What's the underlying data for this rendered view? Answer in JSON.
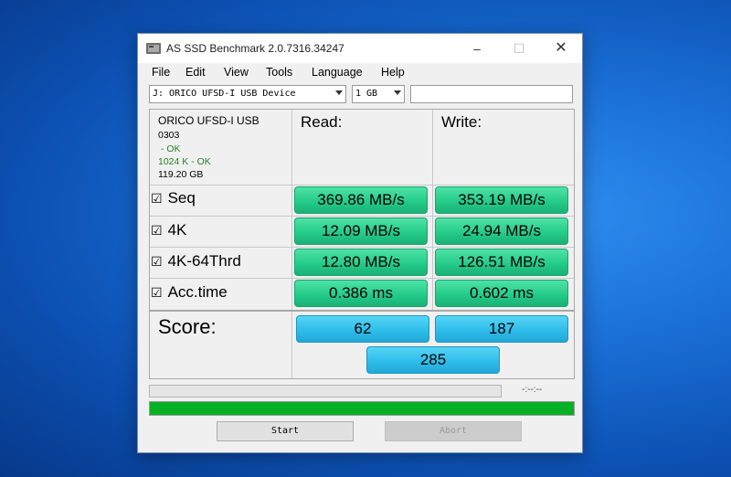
{
  "window": {
    "title": "AS SSD Benchmark 2.0.7316.34247"
  },
  "menu": [
    "File",
    "Edit",
    "View",
    "Tools",
    "Language",
    "Help"
  ],
  "toolbar": {
    "drive_select": "J: ORICO UFSD-I USB Device",
    "size_select": "1 GB",
    "text_field": ""
  },
  "device": {
    "name": "ORICO UFSD-I USB",
    "firmware": "0303",
    "status1": " - OK",
    "status2": "1024 K - OK",
    "capacity": "119.20 GB"
  },
  "columns": {
    "read": "Read:",
    "write": "Write:"
  },
  "tests": [
    {
      "label": "Seq",
      "read": "369.86 MB/s",
      "write": "353.19 MB/s"
    },
    {
      "label": "4K",
      "read": "12.09 MB/s",
      "write": "24.94 MB/s"
    },
    {
      "label": "4K-64Thrd",
      "read": "12.80 MB/s",
      "write": "126.51 MB/s"
    },
    {
      "label": "Acc.time",
      "read": "0.386 ms",
      "write": "0.602 ms"
    }
  ],
  "score": {
    "label": "Score:",
    "read": "62",
    "write": "187",
    "total": "285"
  },
  "progress": {
    "time": "-:--:--",
    "overall_fraction": 1.0
  },
  "buttons": {
    "start": "Start",
    "abort": "Abort"
  },
  "check_glyph": "☑"
}
